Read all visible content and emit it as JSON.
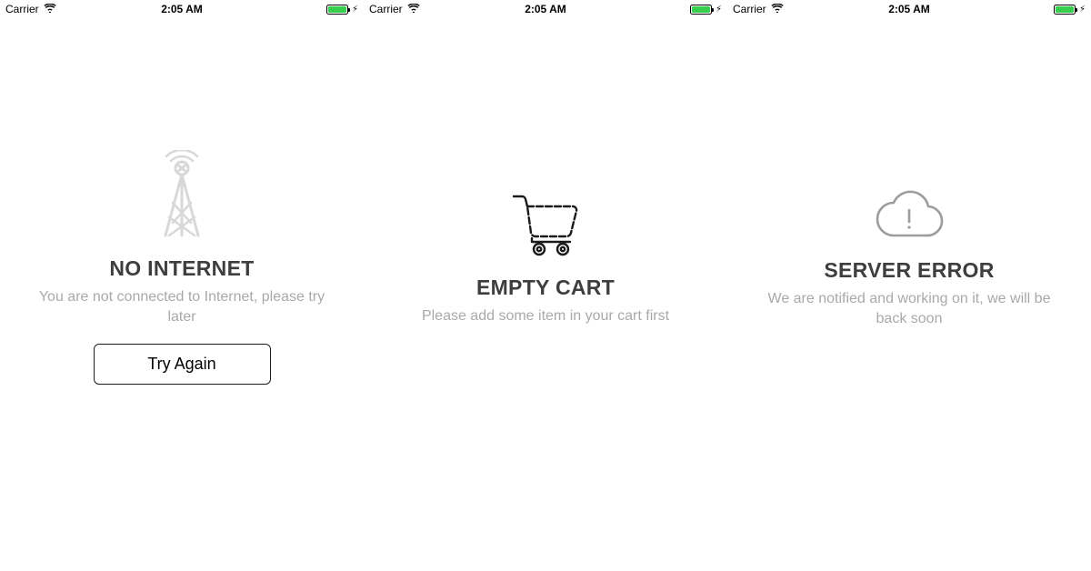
{
  "status": {
    "carrier": "Carrier",
    "time": "2:05 AM"
  },
  "screens": [
    {
      "icon": "antenna-icon",
      "title": "NO INTERNET",
      "subtitle": "You are not connected to Internet, please try later",
      "action": "Try Again"
    },
    {
      "icon": "cart-icon",
      "title": "EMPTY CART",
      "subtitle": "Please add some item in your cart first",
      "action": null
    },
    {
      "icon": "cloud-error-icon",
      "title": "SERVER ERROR",
      "subtitle": "We are notified and working on it, we will be back soon",
      "action": null
    }
  ]
}
